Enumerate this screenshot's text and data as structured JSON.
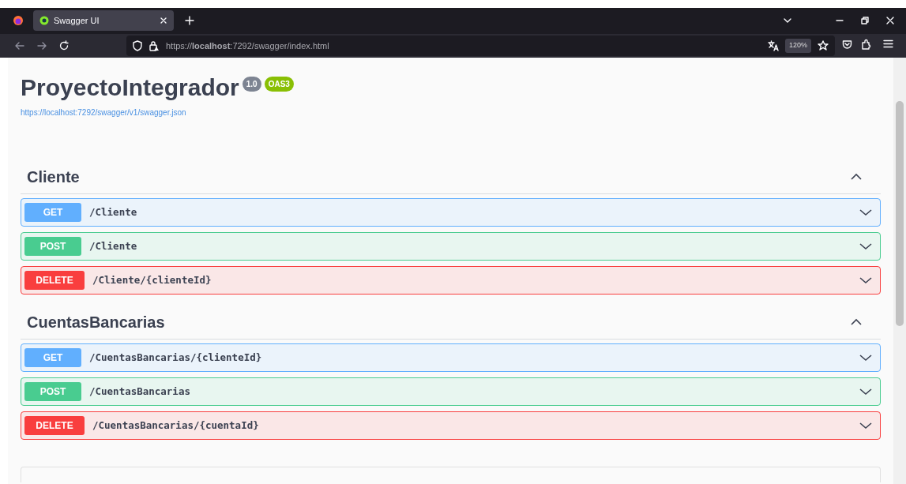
{
  "browser": {
    "tab": {
      "title": "Swagger UI",
      "selected": true
    },
    "url": "https://**localhost**:7292/swagger/index.html",
    "zoom": "120%"
  },
  "info": {
    "title": "ProyectoIntegrador",
    "version": "1.0",
    "oas": "OAS3",
    "spec_url": "https://localhost:7292/swagger/v1/swagger.json"
  },
  "sections": [
    {
      "name": "Cliente",
      "expanded": true,
      "operations": [
        {
          "method": "GET",
          "path": "/Cliente",
          "expanded": false
        },
        {
          "method": "POST",
          "path": "/Cliente",
          "expanded": false
        },
        {
          "method": "DELETE",
          "path": "/Cliente/{clienteId}",
          "expanded": false
        }
      ]
    },
    {
      "name": "CuentasBancarias",
      "expanded": true,
      "operations": [
        {
          "method": "GET",
          "path": "/CuentasBancarias/{clienteId}",
          "expanded": false
        },
        {
          "method": "POST",
          "path": "/CuentasBancarias",
          "expanded": false
        },
        {
          "method": "DELETE",
          "path": "/CuentasBancarias/{cuentaId}",
          "expanded": false
        }
      ]
    }
  ]
}
